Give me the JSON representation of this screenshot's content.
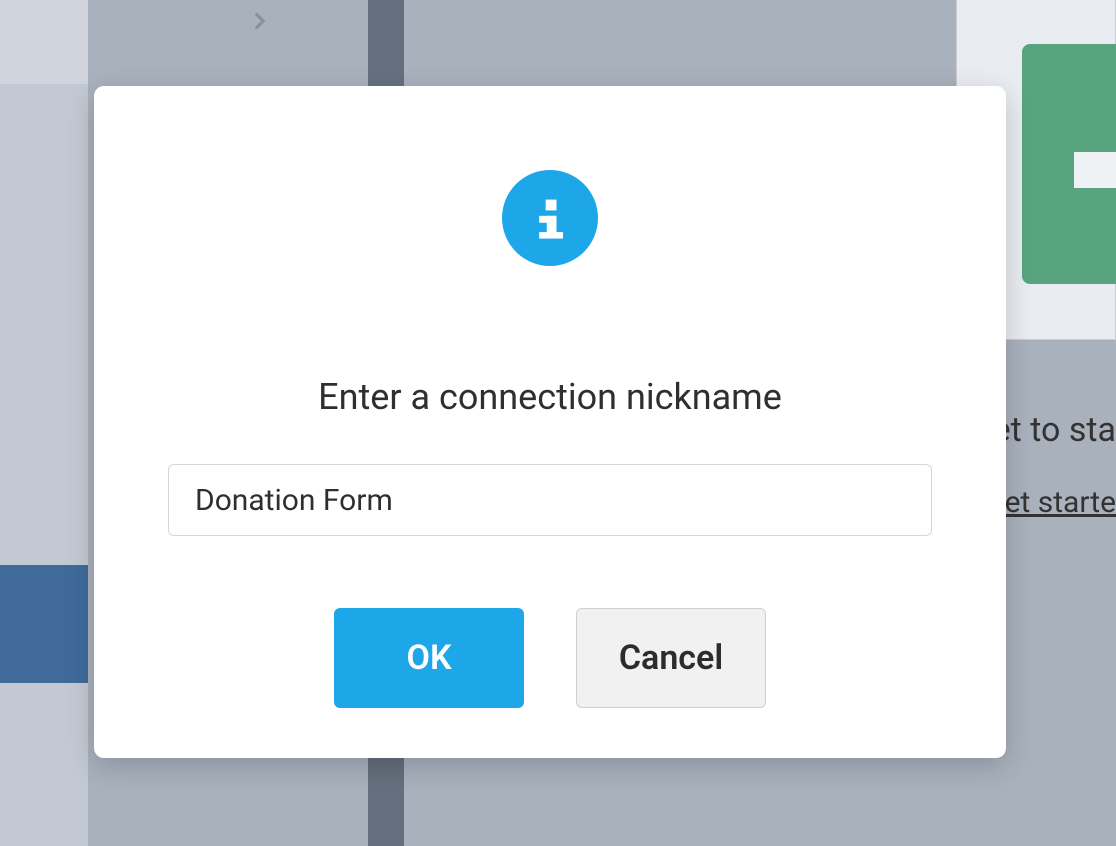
{
  "background": {
    "partial_text_1": "et to sta",
    "partial_link_1": "et starte"
  },
  "modal": {
    "title": "Enter a connection nickname",
    "input_value": "Donation Form",
    "ok_label": "OK",
    "cancel_label": "Cancel"
  },
  "icons": {
    "info": "info-icon",
    "chevron_right": "chevron-right-icon",
    "sheets": "sheets-icon"
  },
  "colors": {
    "accent": "#1ea7e8",
    "green": "#57a47e"
  }
}
